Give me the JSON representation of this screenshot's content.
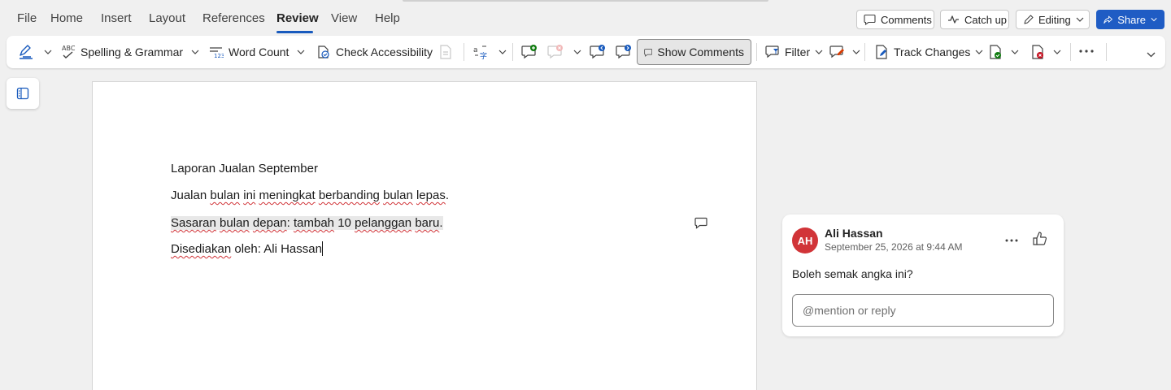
{
  "menu": {
    "items": [
      "File",
      "Home",
      "Insert",
      "Layout",
      "References",
      "Review",
      "View",
      "Help"
    ],
    "active": "Review"
  },
  "top_actions": {
    "comments": "Comments",
    "catch_up": "Catch up",
    "editing": "Editing",
    "share": "Share"
  },
  "ribbon": {
    "spelling": "Spelling & Grammar",
    "word_count": "Word Count",
    "accessibility": "Check Accessibility",
    "show_comments": "Show Comments",
    "filter": "Filter",
    "track_changes": "Track Changes"
  },
  "document": {
    "lines": [
      "Laporan Jualan September",
      "Jualan bulan ini meningkat berbanding bulan lepas.",
      "Sasaran bulan depan: tambah 10 pelanggan baru.",
      "Disediakan oleh: Ali Hassan"
    ]
  },
  "comment": {
    "initials": "AH",
    "author": "Ali Hassan",
    "time": "September 25, 2026 at 9:44 AM",
    "text": "Boleh semak angka ini?",
    "reply_placeholder": "@mention or reply"
  },
  "colors": {
    "accent": "#185abd",
    "share": "#1f5cc4",
    "avatar": "#d13438",
    "spell_error": "#d13438"
  }
}
